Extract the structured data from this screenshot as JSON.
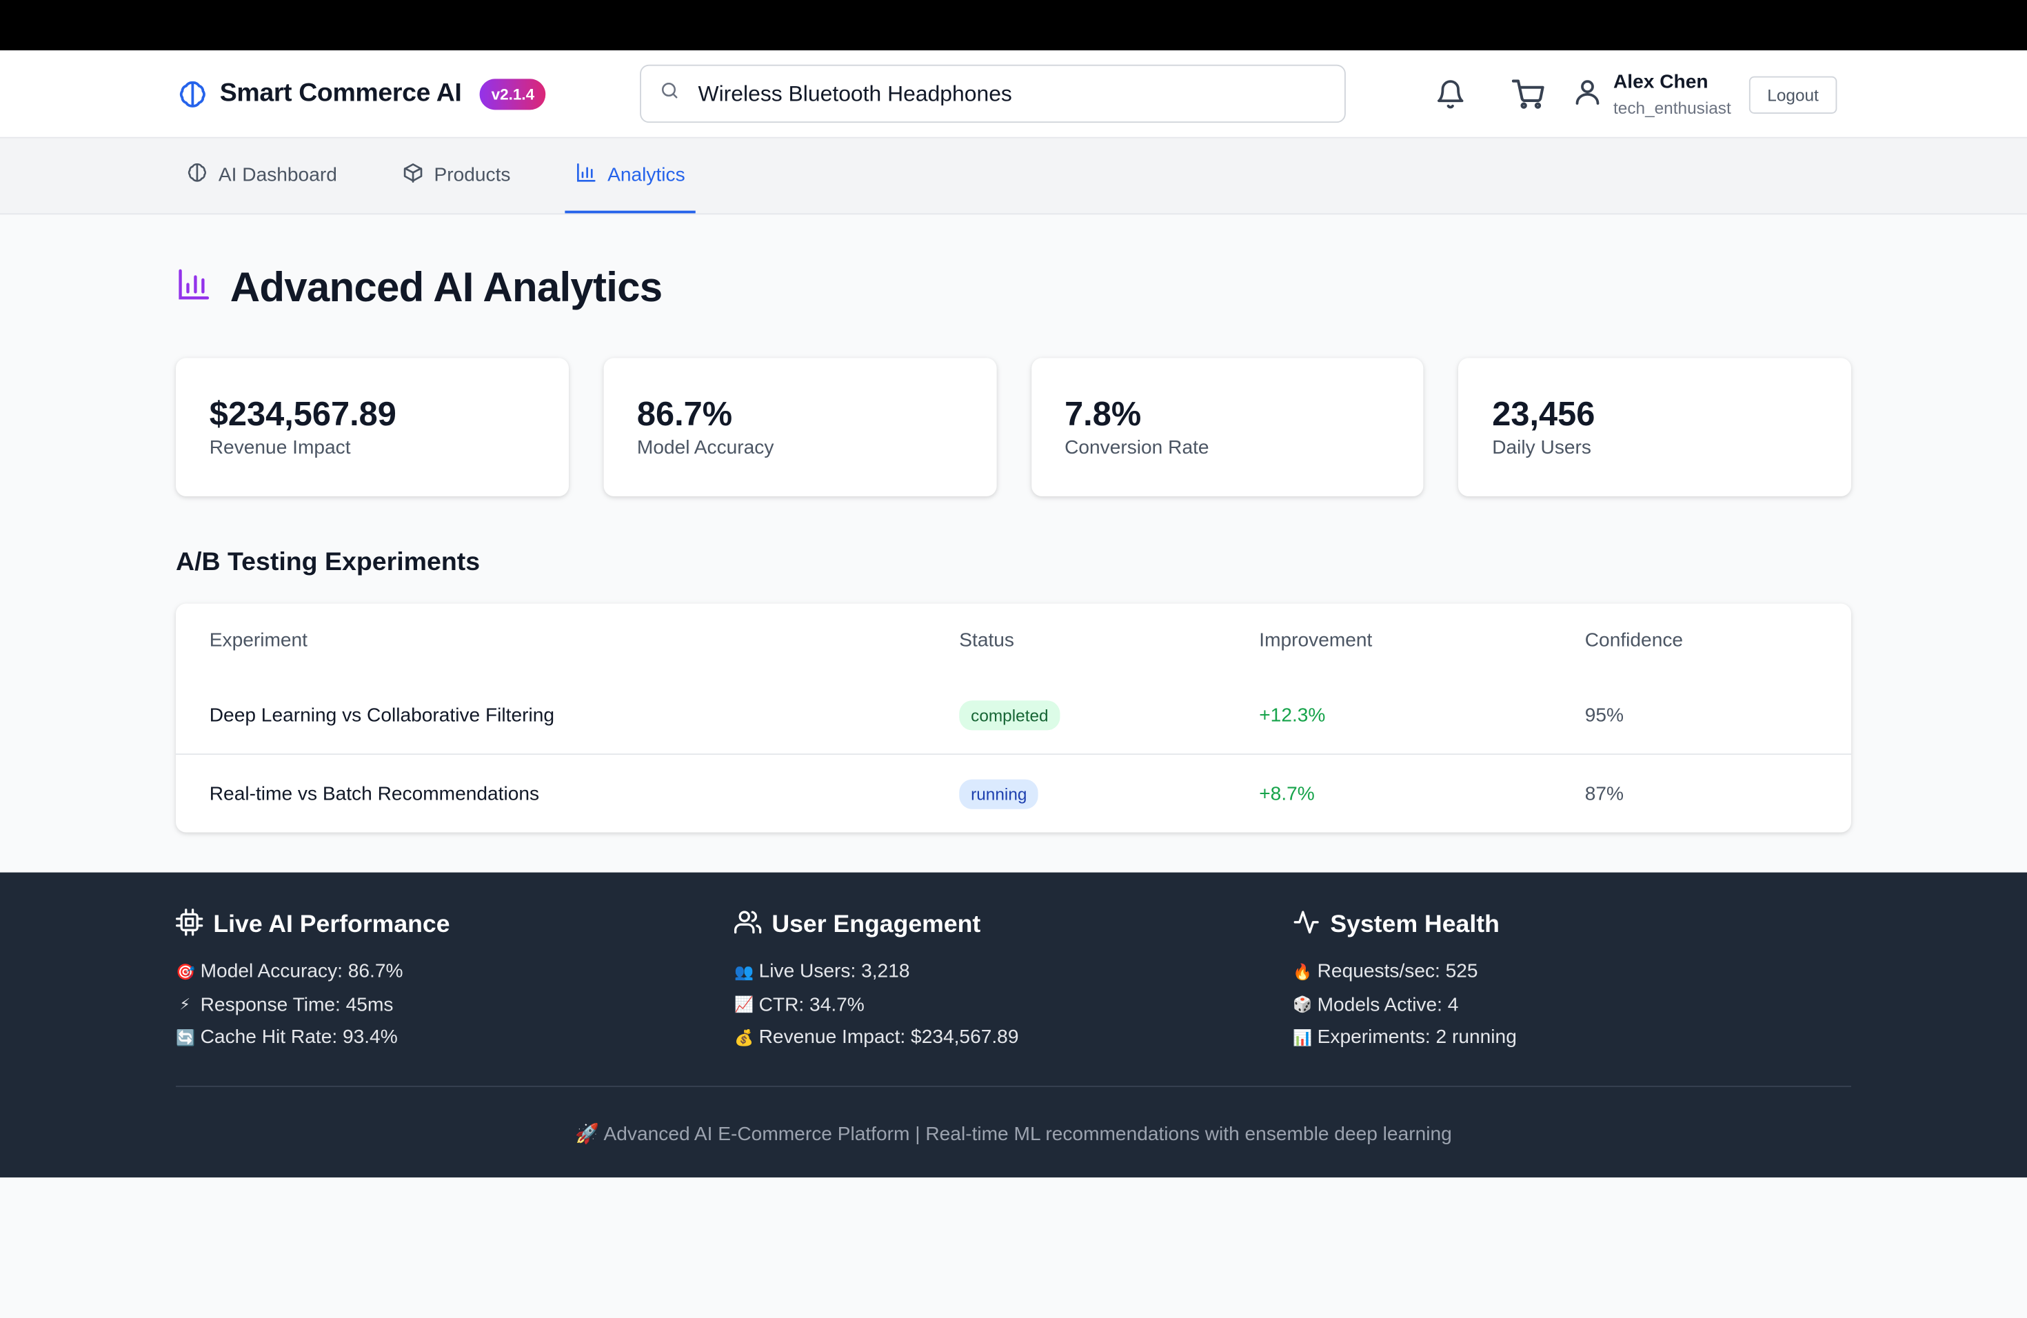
{
  "header": {
    "brand_name": "Smart Commerce AI",
    "version": "v2.1.4",
    "search_value": "Wireless Bluetooth Headphones",
    "user_name": "Alex Chen",
    "user_handle": "tech_enthusiast",
    "logout_label": "Logout"
  },
  "nav": {
    "tabs": [
      {
        "label": "AI Dashboard",
        "icon": "brain-icon"
      },
      {
        "label": "Products",
        "icon": "box-icon"
      },
      {
        "label": "Analytics",
        "icon": "bar-chart-icon",
        "active": true
      }
    ]
  },
  "page": {
    "title": "Advanced AI Analytics"
  },
  "metrics": [
    {
      "value": "$234,567.89",
      "label": "Revenue Impact"
    },
    {
      "value": "86.7%",
      "label": "Model Accuracy"
    },
    {
      "value": "7.8%",
      "label": "Conversion Rate"
    },
    {
      "value": "23,456",
      "label": "Daily Users"
    }
  ],
  "experiments": {
    "title": "A/B Testing Experiments",
    "columns": [
      "Experiment",
      "Status",
      "Improvement",
      "Confidence"
    ],
    "rows": [
      {
        "name": "Deep Learning vs Collaborative Filtering",
        "status": "completed",
        "improvement": "+12.3%",
        "confidence": "95%"
      },
      {
        "name": "Real-time vs Batch Recommendations",
        "status": "running",
        "improvement": "+8.7%",
        "confidence": "87%"
      }
    ]
  },
  "footer": {
    "columns": [
      {
        "title": "Live AI Performance",
        "icon": "cpu-icon",
        "items": [
          {
            "emoji": "🎯",
            "text": "Model Accuracy: 86.7%"
          },
          {
            "emoji": "⚡",
            "text": "Response Time: 45ms"
          },
          {
            "emoji": "🔄",
            "text": "Cache Hit Rate: 93.4%"
          }
        ]
      },
      {
        "title": "User Engagement",
        "icon": "users-icon",
        "items": [
          {
            "emoji": "👥",
            "text": "Live Users: 3,218"
          },
          {
            "emoji": "📈",
            "text": "CTR: 34.7%"
          },
          {
            "emoji": "💰",
            "text": "Revenue Impact: $234,567.89"
          }
        ]
      },
      {
        "title": "System Health",
        "icon": "activity-icon",
        "items": [
          {
            "emoji": "🔥",
            "text": "Requests/sec: 525"
          },
          {
            "emoji": "🎲",
            "text": "Models Active: 4"
          },
          {
            "emoji": "📊",
            "text": "Experiments: 2 running"
          }
        ]
      }
    ],
    "tagline_emoji": "🚀",
    "tagline": "Advanced AI E-Commerce Platform | Real-time ML recommendations with ensemble deep learning"
  },
  "colors": {
    "accent": "#2563eb",
    "brand_gradient_start": "#9333ea",
    "brand_gradient_end": "#db2777",
    "positive": "#16a34a",
    "footer_bg": "#1f2937"
  }
}
